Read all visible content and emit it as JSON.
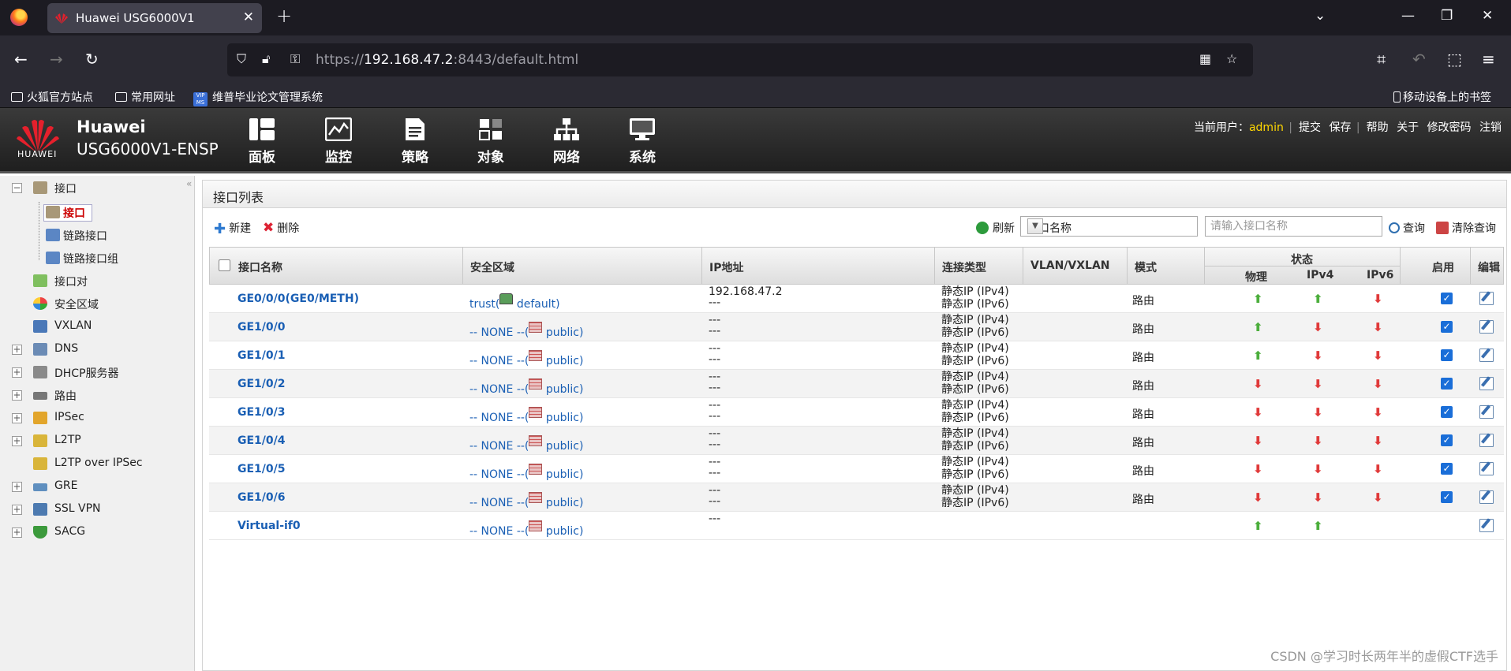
{
  "browser": {
    "tab_title": "Huawei USG6000V1",
    "tab_close": "✕",
    "new_tab": "+",
    "url_prefix": "https://",
    "url_host": "192.168.47.2",
    "url_rest": ":8443/default.html",
    "bookmarks": [
      "火狐官方站点",
      "常用网址",
      "维普毕业论文管理系统"
    ],
    "vip_logo": "VIP MS",
    "mobile_bookmarks": "移动设备上的书签"
  },
  "header": {
    "logo_text": "HUAWEI",
    "brand": "Huawei",
    "model": "USG6000V1-ENSP",
    "menu": [
      "面板",
      "监控",
      "策略",
      "对象",
      "网络",
      "系统"
    ],
    "current_user_label": "当前用户：",
    "user": "admin",
    "links": [
      "提交",
      "保存",
      "帮助",
      "关于",
      "修改密码",
      "注销"
    ]
  },
  "sidebar": {
    "collapse": "«",
    "items": [
      {
        "label": "接口"
      },
      {
        "label": "接口"
      },
      {
        "label": "链路接口"
      },
      {
        "label": "链路接口组"
      },
      {
        "label": "接口对"
      },
      {
        "label": "安全区域"
      },
      {
        "label": "VXLAN"
      },
      {
        "label": "DNS"
      },
      {
        "label": "DHCP服务器"
      },
      {
        "label": "路由"
      },
      {
        "label": "IPSec"
      },
      {
        "label": "L2TP"
      },
      {
        "label": "L2TP over IPSec"
      },
      {
        "label": "GRE"
      },
      {
        "label": "SSL VPN"
      },
      {
        "label": "SACG"
      }
    ]
  },
  "panel": {
    "title": "接口列表",
    "new_label": "新建",
    "delete_label": "删除",
    "refresh_label": "刷新",
    "select_value": "接口名称",
    "search_placeholder": "请输入接口名称",
    "query_label": "查询",
    "clear_label": "清除查询"
  },
  "table": {
    "headers": {
      "name": "接口名称",
      "zone": "安全区域",
      "ip": "IP地址",
      "conn": "连接类型",
      "vlan": "VLAN/VXLAN",
      "mode": "模式",
      "status": "状态",
      "phys": "物理",
      "ipv4": "IPv4",
      "ipv6": "IPv6",
      "enable": "启用",
      "edit": "编辑"
    },
    "rows": [
      {
        "name": "GE0/0/0(GE0/METH)",
        "zone_a": "trust(",
        "zone_b": " default)",
        "ip1": "192.168.47.2",
        "ip2": "---",
        "conn1": "静态IP (IPv4)",
        "conn2": "静态IP (IPv6)",
        "mode": "路由",
        "phys": "up",
        "ipv4": "up",
        "ipv6": "down",
        "enabled": true
      },
      {
        "name": "GE1/0/0",
        "zone_a": "-- NONE --(",
        "zone_b": " public)",
        "ip1": "---",
        "ip2": "---",
        "conn1": "静态IP (IPv4)",
        "conn2": "静态IP (IPv6)",
        "mode": "路由",
        "phys": "up",
        "ipv4": "down",
        "ipv6": "down",
        "enabled": true
      },
      {
        "name": "GE1/0/1",
        "zone_a": "-- NONE --(",
        "zone_b": " public)",
        "ip1": "---",
        "ip2": "---",
        "conn1": "静态IP (IPv4)",
        "conn2": "静态IP (IPv6)",
        "mode": "路由",
        "phys": "up",
        "ipv4": "down",
        "ipv6": "down",
        "enabled": true
      },
      {
        "name": "GE1/0/2",
        "zone_a": "-- NONE --(",
        "zone_b": " public)",
        "ip1": "---",
        "ip2": "---",
        "conn1": "静态IP (IPv4)",
        "conn2": "静态IP (IPv6)",
        "mode": "路由",
        "phys": "down",
        "ipv4": "down",
        "ipv6": "down",
        "enabled": true
      },
      {
        "name": "GE1/0/3",
        "zone_a": "-- NONE --(",
        "zone_b": " public)",
        "ip1": "---",
        "ip2": "---",
        "conn1": "静态IP (IPv4)",
        "conn2": "静态IP (IPv6)",
        "mode": "路由",
        "phys": "down",
        "ipv4": "down",
        "ipv6": "down",
        "enabled": true
      },
      {
        "name": "GE1/0/4",
        "zone_a": "-- NONE --(",
        "zone_b": " public)",
        "ip1": "---",
        "ip2": "---",
        "conn1": "静态IP (IPv4)",
        "conn2": "静态IP (IPv6)",
        "mode": "路由",
        "phys": "down",
        "ipv4": "down",
        "ipv6": "down",
        "enabled": true
      },
      {
        "name": "GE1/0/5",
        "zone_a": "-- NONE --(",
        "zone_b": " public)",
        "ip1": "---",
        "ip2": "---",
        "conn1": "静态IP (IPv4)",
        "conn2": "静态IP (IPv6)",
        "mode": "路由",
        "phys": "down",
        "ipv4": "down",
        "ipv6": "down",
        "enabled": true
      },
      {
        "name": "GE1/0/6",
        "zone_a": "-- NONE --(",
        "zone_b": " public)",
        "ip1": "---",
        "ip2": "---",
        "conn1": "静态IP (IPv4)",
        "conn2": "静态IP (IPv6)",
        "mode": "路由",
        "phys": "down",
        "ipv4": "down",
        "ipv6": "down",
        "enabled": true
      },
      {
        "name": "Virtual-if0",
        "zone_a": "-- NONE --(",
        "zone_b": " public)",
        "ip1": "---",
        "ip2": "",
        "conn1": "",
        "conn2": "",
        "mode": "",
        "phys": "up",
        "ipv4": "up",
        "ipv6": "",
        "enabled": false
      }
    ]
  },
  "colors": {
    "link_blue": "#1a5fb4",
    "up_green": "#4cae3c",
    "down_red": "#e03a3a",
    "user_yellow": "#ffd700"
  },
  "watermark": "CSDN @学习时长两年半的虚假CTF选手"
}
